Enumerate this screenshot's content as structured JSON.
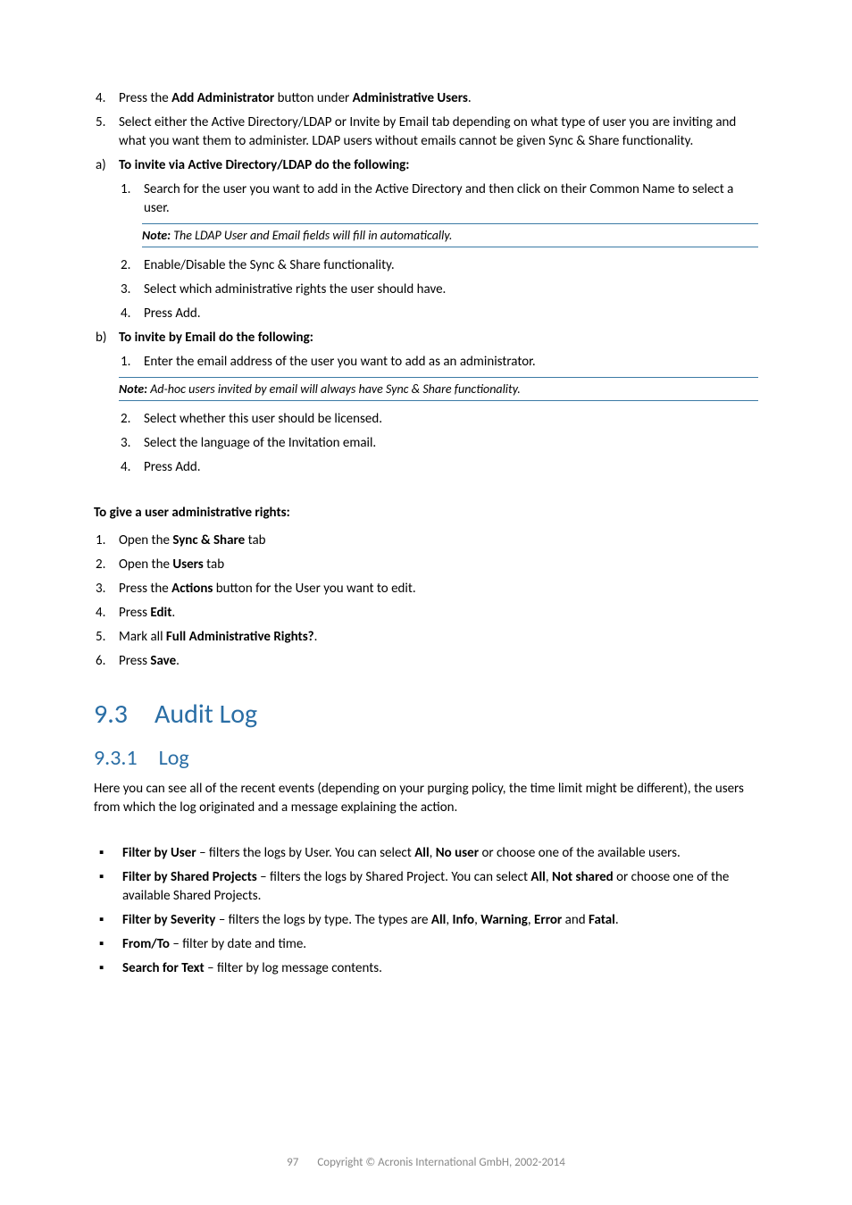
{
  "list1_4_pre": "Press the ",
  "list1_4_b1": "Add Administrator",
  "list1_4_mid": " button under ",
  "list1_4_b2": "Administrative Users",
  "list1_4_post": ".",
  "list1_5": "Select either the Active Directory/LDAP or Invite by Email tab depending on what type of user you are inviting and what you want them to administer. LDAP users without emails cannot be given Sync & Share functionality.",
  "a_title": "To invite via Active Directory/LDAP do the following:",
  "a1": "Search for the user you want to add in the Active Directory and then click on their Common Name to select a user.",
  "note1_lbl": "Note:",
  "note1_txt": " The LDAP User and Email fields will fill in automatically.",
  "a2": "Enable/Disable the Sync & Share functionality.",
  "a3": "Select which administrative rights the user should have.",
  "a4": "Press Add.",
  "b_title": "To invite by Email do the following:",
  "b1": "Enter the email address of the user you want to add as an administrator.",
  "note2_lbl": "Note:",
  "note2_txt": " Ad-hoc users invited by email will always have Sync & Share functionality.",
  "b2": "Select whether this user should be licensed.",
  "b3": "Select the language of the Invitation email.",
  "b4": "Press Add.",
  "rights_title": "To give a user administrative rights:",
  "r1_pre": "Open the ",
  "r1_b": "Sync & Share",
  "r1_post": " tab",
  "r2_pre": "Open the ",
  "r2_b": "Users",
  "r2_post": " tab",
  "r3_pre": "Press the ",
  "r3_b": "Actions",
  "r3_post": " button for the User you want to edit.",
  "r4_pre": "Press ",
  "r4_b": "Edit",
  "r4_post": ".",
  "r5_pre": "Mark all ",
  "r5_b": "Full Administrative Rights?",
  "r5_post": ".",
  "r6_pre": "Press ",
  "r6_b": "Save",
  "r6_post": ".",
  "h93": "9.3 Audit Log",
  "h931": "9.3.1 Log",
  "logp": "Here you can see all of the recent events (depending on your purging policy, the time limit might be different), the users from which the log originated and a message explaining the action.",
  "fb1_b": "Filter by User",
  "fb1_t1": " – filters the logs by User. You can select ",
  "fb1_b2": "All",
  "fb1_t2": ", ",
  "fb1_b3": "No user",
  "fb1_t3": " or choose one of the available users.",
  "fb2_b": "Filter by Shared Projects",
  "fb2_t1": " – filters the logs by Shared Project. You can select ",
  "fb2_b2": "All",
  "fb2_t2": ", ",
  "fb2_b3": "Not shared",
  "fb2_t3": " or choose one of the available Shared Projects.",
  "fb3_b": "Filter by Severity",
  "fb3_t1": " – filters the logs by type. The types are ",
  "fb3_b2": "All",
  "fb3_t2": ", ",
  "fb3_b3": "Info",
  "fb3_t3": ", ",
  "fb3_b4": "Warning",
  "fb3_t4": ", ",
  "fb3_b5": "Error",
  "fb3_t5": " and ",
  "fb3_b6": "Fatal",
  "fb3_t6": ".",
  "fb4_b": "From/To",
  "fb4_t": " – filter by date and time.",
  "fb5_b": "Search for Text",
  "fb5_t": " – filter by log message contents.",
  "pagenum": "97",
  "copyright": "Copyright © Acronis International GmbH, 2002-2014"
}
